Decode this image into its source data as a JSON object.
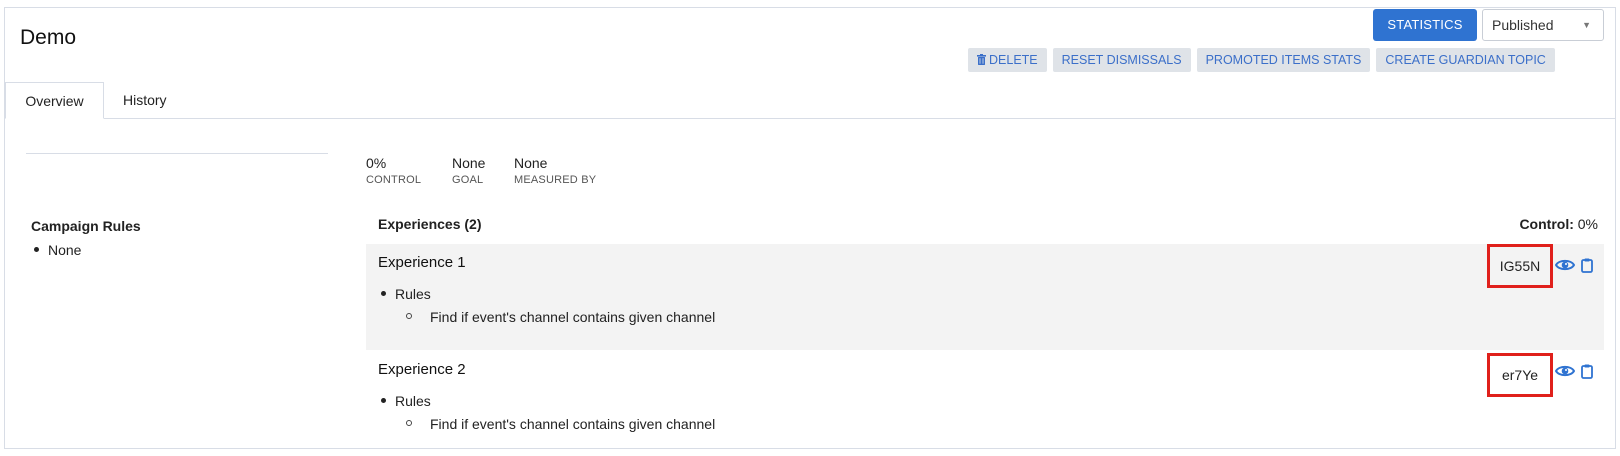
{
  "header": {
    "title": "Demo",
    "statistics_button": "STATISTICS",
    "status_select": "Published",
    "actions": {
      "delete": "DELETE",
      "reset_dismissals": "RESET DISMISSALS",
      "promoted_items_stats": "PROMOTED ITEMS STATS",
      "create_guardian_topic": "CREATE GUARDIAN TOPIC"
    }
  },
  "tabs": [
    {
      "label": "Overview",
      "active": true
    },
    {
      "label": "History",
      "active": false
    }
  ],
  "campaign_rules": {
    "title": "Campaign Rules",
    "items": [
      "None"
    ]
  },
  "stats": [
    {
      "value": "0%",
      "label": "CONTROL"
    },
    {
      "value": "None",
      "label": "GOAL"
    },
    {
      "value": "None",
      "label": "MEASURED BY"
    }
  ],
  "experiences": {
    "heading": "Experiences (2)",
    "control_label": "Control:",
    "control_value": "0%",
    "items": [
      {
        "name": "Experience 1",
        "rule_label": "Rules",
        "rule": "Find if event's channel contains given channel",
        "code": "IG55N"
      },
      {
        "name": "Experience 2",
        "rule_label": "Rules",
        "rule": "Find if event's channel contains given channel",
        "code": "er7Ye"
      }
    ]
  },
  "colors": {
    "primary": "#2f73d1",
    "highlight_box": "#e0201b",
    "icon_blue": "#2f73d1"
  }
}
